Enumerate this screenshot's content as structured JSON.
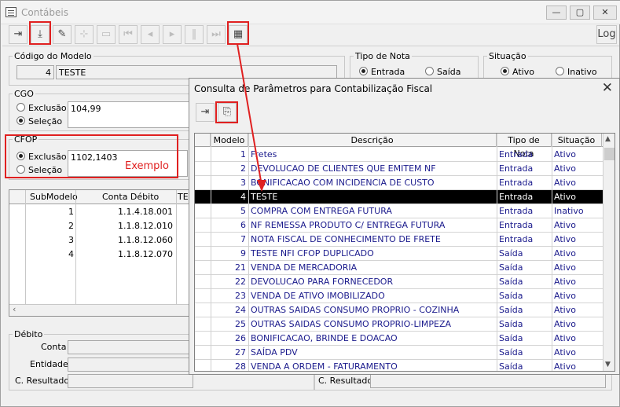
{
  "app": {
    "title": "Contábeis",
    "log_label": "Log"
  },
  "toolbar": {
    "buttons": [
      {
        "name": "exit-door-icon",
        "glyph": "⇥"
      },
      {
        "name": "download-icon",
        "glyph": "⤓"
      },
      {
        "name": "eraser-icon",
        "glyph": "✎"
      },
      {
        "name": "tree-icon",
        "glyph": "⊹"
      },
      {
        "name": "open-folder-icon",
        "glyph": "▭"
      },
      {
        "name": "first-icon",
        "glyph": "⏮"
      },
      {
        "name": "prev-icon",
        "glyph": "◂"
      },
      {
        "name": "next-icon",
        "glyph": "▸"
      },
      {
        "name": "pause-icon",
        "glyph": "‖"
      },
      {
        "name": "last-icon",
        "glyph": "⏭"
      },
      {
        "name": "grid-icon",
        "glyph": "▦"
      }
    ]
  },
  "modelo": {
    "legend": "Código do Modelo",
    "code": "4",
    "name": "TESTE"
  },
  "tipo_nota": {
    "legend": "Tipo de Nota",
    "entrada": "Entrada",
    "saida": "Saída"
  },
  "situacao": {
    "legend": "Situação",
    "ativo": "Ativo",
    "inativo": "Inativo"
  },
  "cgo": {
    "legend": "CGO",
    "exclusao": "Exclusão",
    "selecao": "Seleção",
    "value": "104,99"
  },
  "cfop": {
    "legend": "CFOP",
    "exclusao": "Exclusão",
    "selecao": "Seleção",
    "value": "1102,1403",
    "note": "Exemplo"
  },
  "subgrid": {
    "headers": [
      "SubModelo",
      "Conta Débito",
      "TE"
    ],
    "rows": [
      [
        "1",
        "1.1.4.18.001"
      ],
      [
        "2",
        "1.1.8.12.010"
      ],
      [
        "3",
        "1.1.8.12.060"
      ],
      [
        "4",
        "1.1.8.12.070"
      ]
    ]
  },
  "debito": {
    "legend": "Débito",
    "conta": "Conta",
    "entidade": "Entidade",
    "c_resultado": "C. Resultado"
  },
  "credito": {
    "c_resultado": "C. Resultado"
  },
  "dialog": {
    "title": "Consulta de Parâmetros para Contabilização Fiscal",
    "close": "✕",
    "headers": [
      "Modelo",
      "Descrição",
      "Tipo de Nota",
      "Situação"
    ],
    "rows": [
      [
        "1",
        "Fretes",
        "Entrada",
        "Ativo"
      ],
      [
        "2",
        "DEVOLUCAO DE CLIENTES QUE EMITEM NF",
        "Entrada",
        "Ativo"
      ],
      [
        "3",
        "BONIFICACAO COM INCIDENCIA DE CUSTO",
        "Entrada",
        "Ativo"
      ],
      [
        "4",
        "TESTE",
        "Entrada",
        "Ativo"
      ],
      [
        "5",
        "COMPRA COM ENTREGA FUTURA",
        "Entrada",
        "Inativo"
      ],
      [
        "6",
        "NF REMESSA PRODUTO C/ ENTREGA FUTURA",
        "Entrada",
        "Ativo"
      ],
      [
        "7",
        "NOTA FISCAL DE CONHECIMENTO DE FRETE",
        "Entrada",
        "Ativo"
      ],
      [
        "9",
        "TESTE NFI CFOP DUPLICADO",
        "Saída",
        "Ativo"
      ],
      [
        "21",
        "VENDA DE MERCADORIA",
        "Saída",
        "Ativo"
      ],
      [
        "22",
        "DEVOLUCAO PARA FORNECEDOR",
        "Saída",
        "Ativo"
      ],
      [
        "23",
        "VENDA DE ATIVO IMOBILIZADO",
        "Saída",
        "Ativo"
      ],
      [
        "24",
        "OUTRAS SAIDAS CONSUMO PROPRIO - COZINHA",
        "Saída",
        "Ativo"
      ],
      [
        "25",
        "OUTRAS SAIDAS CONSUMO PROPRIO-LIMPEZA",
        "Saída",
        "Ativo"
      ],
      [
        "26",
        "BONIFICACAO, BRINDE E DOACAO",
        "Saída",
        "Ativo"
      ],
      [
        "27",
        "SAÍDA PDV",
        "Saída",
        "Ativo"
      ],
      [
        "28",
        "VENDA A ORDEM - FATURAMENTO",
        "Saída",
        "Ativo"
      ]
    ],
    "selected_index": 3
  },
  "colors": {
    "highlight": "#e02020",
    "grid_text": "#1a1a8c"
  }
}
